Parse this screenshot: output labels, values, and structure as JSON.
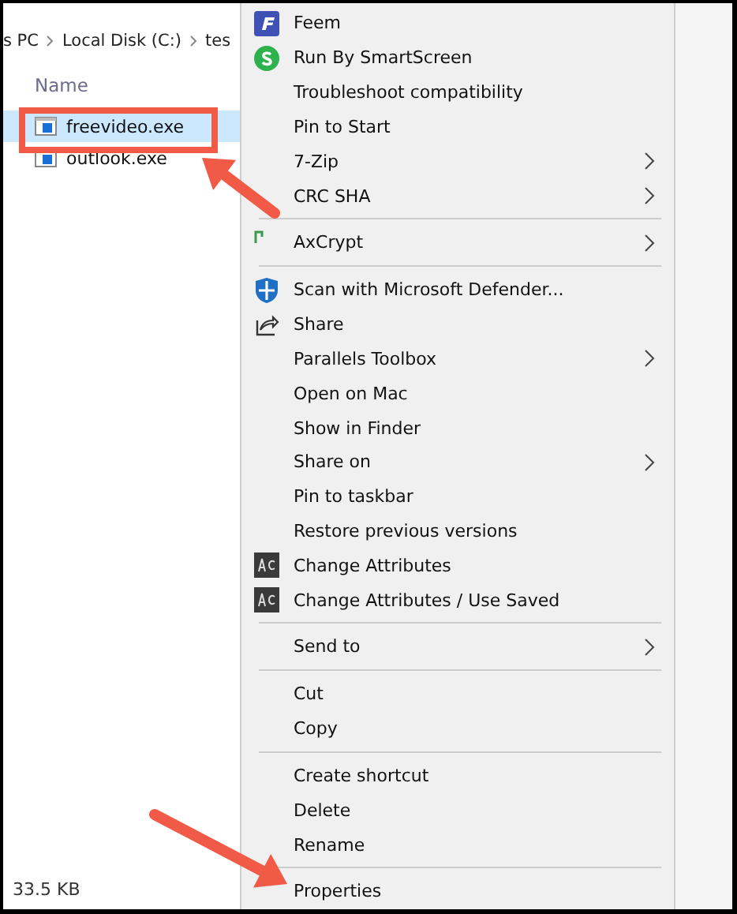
{
  "breadcrumb": [
    "s PC",
    "Local Disk (C:)",
    "tes"
  ],
  "column_header": "Name",
  "files": [
    {
      "name": "freevideo.exe",
      "selected": true
    },
    {
      "name": "outlook.exe",
      "selected": false
    }
  ],
  "status_bar": "33.5 KB",
  "context_menu": [
    {
      "kind": "item",
      "label": "Feem",
      "submenu": false
    },
    {
      "kind": "item",
      "label": "Run By SmartScreen",
      "submenu": false
    },
    {
      "kind": "item",
      "label": "Troubleshoot compatibility",
      "submenu": false
    },
    {
      "kind": "item",
      "label": "Pin to Start",
      "submenu": false
    },
    {
      "kind": "item",
      "label": "7-Zip",
      "submenu": true
    },
    {
      "kind": "item",
      "label": "CRC SHA",
      "submenu": true
    },
    {
      "kind": "separator"
    },
    {
      "kind": "item",
      "label": "AxCrypt",
      "submenu": true
    },
    {
      "kind": "separator"
    },
    {
      "kind": "item",
      "label": "Scan with Microsoft Defender...",
      "submenu": false
    },
    {
      "kind": "item",
      "label": "Share",
      "submenu": false
    },
    {
      "kind": "item",
      "label": "Parallels Toolbox",
      "submenu": true
    },
    {
      "kind": "item",
      "label": "Open on Mac",
      "submenu": false
    },
    {
      "kind": "item",
      "label": "Show in Finder",
      "submenu": false
    },
    {
      "kind": "item",
      "label": "Share on",
      "submenu": true
    },
    {
      "kind": "item",
      "label": "Pin to taskbar",
      "submenu": false
    },
    {
      "kind": "item",
      "label": "Restore previous versions",
      "submenu": false
    },
    {
      "kind": "item",
      "label": "Change Attributes",
      "submenu": false
    },
    {
      "kind": "item",
      "label": "Change Attributes / Use Saved",
      "submenu": false
    },
    {
      "kind": "separator"
    },
    {
      "kind": "item",
      "label": "Send to",
      "submenu": true
    },
    {
      "kind": "separator"
    },
    {
      "kind": "item",
      "label": "Cut",
      "submenu": false
    },
    {
      "kind": "item",
      "label": "Copy",
      "submenu": false
    },
    {
      "kind": "separator"
    },
    {
      "kind": "item",
      "label": "Create shortcut",
      "submenu": false
    },
    {
      "kind": "item",
      "label": "Delete",
      "submenu": false
    },
    {
      "kind": "item",
      "label": "Rename",
      "submenu": false
    },
    {
      "kind": "separator"
    },
    {
      "kind": "item",
      "label": "Properties",
      "submenu": false
    }
  ]
}
